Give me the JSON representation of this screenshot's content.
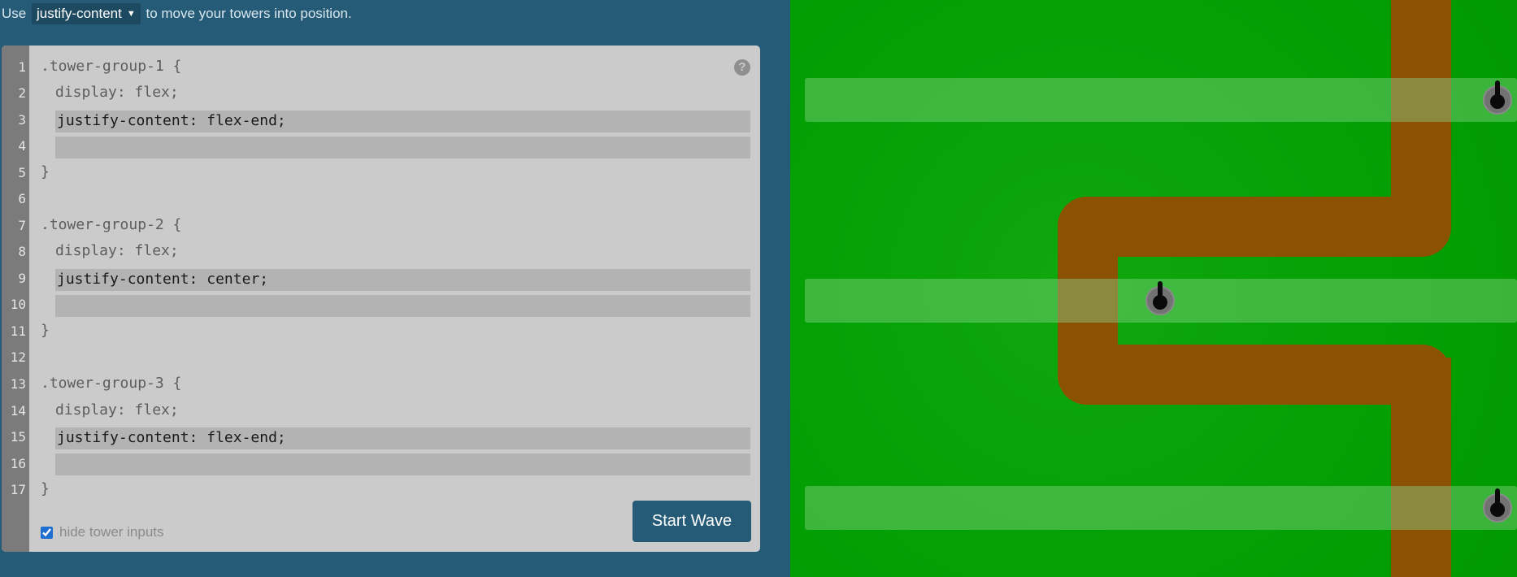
{
  "instruction": {
    "prefix": "Use",
    "property": "justify-content",
    "suffix": "to move your towers into position."
  },
  "editor": {
    "line_numbers": [
      "1",
      "2",
      "3",
      "4",
      "5",
      "6",
      "7",
      "8",
      "9",
      "10",
      "11",
      "12",
      "13",
      "14",
      "15",
      "16",
      "17"
    ],
    "lines": {
      "l1": ".tower-group-1 {",
      "l2": "display: flex;",
      "l3": "justify-content: flex-end;",
      "l5": "}",
      "l7": ".tower-group-2 {",
      "l8": "display: flex;",
      "l9": "justify-content: center;",
      "l11": "}",
      "l13": ".tower-group-3 {",
      "l14": "display: flex;",
      "l15": "justify-content: flex-end;",
      "l17": "}"
    },
    "help_icon": "question-circle-icon",
    "help_glyph": "?",
    "hide_inputs_label": "hide tower inputs",
    "hide_inputs_checked": true,
    "start_button": "Start Wave"
  },
  "colors": {
    "panel": "#255b77",
    "editor_bg": "#cbcbcb",
    "grass": "#04a004",
    "path": "#8b5204",
    "button": "#255b77"
  }
}
